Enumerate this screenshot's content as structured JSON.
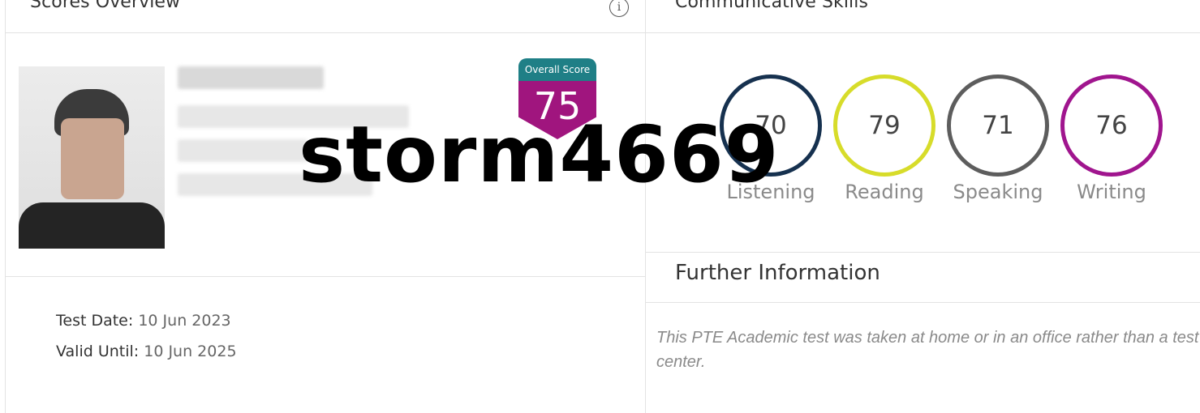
{
  "scores_overview": {
    "title": "Scores Overview",
    "info_icon": "info-icon",
    "overall_score": {
      "label": "Overall Score",
      "value": "75"
    },
    "test_date": {
      "label": "Test Date:",
      "value": "10 Jun 2023"
    },
    "valid_until": {
      "label": "Valid Until:",
      "value": "10 Jun 2025"
    }
  },
  "communicative_skills": {
    "title": "Communicative Skills",
    "skills": [
      {
        "label": "Listening",
        "score": "70",
        "color": "#16314f"
      },
      {
        "label": "Reading",
        "score": "79",
        "color": "#d7dc2a"
      },
      {
        "label": "Speaking",
        "score": "71",
        "color": "#5d5d5d"
      },
      {
        "label": "Writing",
        "score": "76",
        "color": "#a0158e"
      }
    ]
  },
  "further_information": {
    "title": "Further Information",
    "text": "This PTE Academic test was taken at home or in an office rather than a test center."
  },
  "watermark": "storm4669",
  "colors": {
    "badge_top": "#1f7f86",
    "badge_bottom": "#a0157e"
  }
}
